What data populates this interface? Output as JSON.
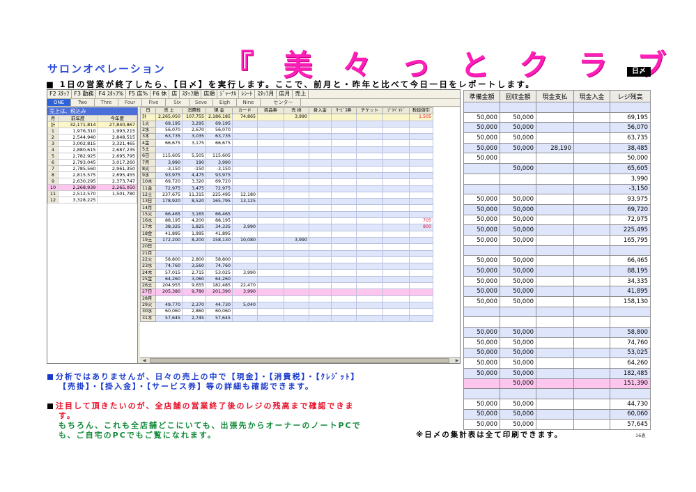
{
  "header": {
    "subtitle": "サロンオペレーション",
    "brand": "『 美 々 っ と ク ラ ブ 』",
    "icon_label": "日〆",
    "intro": "■ 1日の営業が終了したら、【日〆】を実行します。ここで、前月と・昨年と比べて今日一日をレポートします。"
  },
  "window": {
    "menu": [
      "F2 ｽﾀｯﾌ",
      "F3 勤務",
      "F4 ｽﾀｯﾌ%",
      "F5 店%",
      "F6 休",
      "店",
      "ｽﾀｯﾌ順",
      "店順",
      "ｼﾞｬｰﾅﾙ",
      "ﾚｼｰﾄ",
      "ｽﾀｯﾌ月",
      "店月",
      "売上"
    ],
    "tabs": [
      "ONE",
      "Two",
      "Thre",
      "Four",
      "Five",
      "Six",
      "Seve",
      "Eigh",
      "Nine"
    ],
    "tab_center": "センター",
    "left_title": "売上は、税込み",
    "left_headers": [
      "月",
      "前年度",
      "今年度"
    ],
    "left_rows": [
      [
        "計",
        "32,171,814",
        "27,840,867"
      ],
      [
        "1",
        "1,976,310",
        "1,993,215"
      ],
      [
        "2",
        "2,544,940",
        "2,848,515"
      ],
      [
        "3",
        "3,002,815",
        "3,321,465"
      ],
      [
        "4",
        "2,880,615",
        "2,687,235"
      ],
      [
        "5",
        "2,782,925",
        "2,695,795"
      ],
      [
        "6",
        "2,793,045",
        "3,017,260"
      ],
      [
        "7",
        "2,785,560",
        "2,961,350"
      ],
      [
        "8",
        "2,815,575",
        "2,695,455"
      ],
      [
        "9",
        "2,630,295",
        "2,373,747"
      ],
      [
        "10",
        "2,268,939",
        "2,265,050"
      ],
      [
        "11",
        "2,512,570",
        "1,501,780"
      ],
      [
        "12",
        "3,328,225",
        ""
      ]
    ],
    "grid_headers": [
      "日",
      "売 上",
      "消費税",
      "現 金",
      "カード",
      "商品券",
      "売 掛",
      "掛入金",
      "ｻｰﾋﾞｽ券",
      "チケット",
      "ﾌﾟﾘﾍﾟｲﾄﾞ",
      "税抜値引"
    ],
    "grid_rows": [
      [
        "計",
        "2,265,050",
        "107,755",
        "2,186,185",
        "74,865",
        "",
        "3,990",
        "",
        "",
        "",
        "",
        "1,505"
      ],
      [
        "1火",
        "69,195",
        "3,295",
        "69,195",
        "",
        "",
        "",
        "",
        "",
        "",
        "",
        ""
      ],
      [
        "2水",
        "56,070",
        "2,670",
        "56,070",
        "",
        "",
        "",
        "",
        "",
        "",
        "",
        ""
      ],
      [
        "3木",
        "63,735",
        "3,035",
        "63,735",
        "",
        "",
        "",
        "",
        "",
        "",
        "",
        ""
      ],
      [
        "4金",
        "66,675",
        "3,175",
        "66,675",
        "",
        "",
        "",
        "",
        "",
        "",
        "",
        ""
      ],
      [
        "5土",
        "",
        "",
        "",
        "",
        "",
        "",
        "",
        "",
        "",
        "",
        ""
      ],
      [
        "6日",
        "115,605",
        "5,505",
        "115,605",
        "",
        "",
        "",
        "",
        "",
        "",
        "",
        ""
      ],
      [
        "7月",
        "3,990",
        "190",
        "3,990",
        "",
        "",
        "",
        "",
        "",
        "",
        "",
        ""
      ],
      [
        "8火",
        "-3,150",
        "-150",
        "-3,150",
        "",
        "",
        "",
        "",
        "",
        "",
        "",
        ""
      ],
      [
        "9水",
        "93,975",
        "4,475",
        "93,975",
        "",
        "",
        "",
        "",
        "",
        "",
        "",
        ""
      ],
      [
        "10木",
        "69,720",
        "3,320",
        "69,720",
        "",
        "",
        "",
        "",
        "",
        "",
        "",
        ""
      ],
      [
        "11金",
        "72,975",
        "3,475",
        "72,975",
        "",
        "",
        "",
        "",
        "",
        "",
        "",
        ""
      ],
      [
        "12土",
        "237,675",
        "11,315",
        "225,495",
        "12,180",
        "",
        "",
        "",
        "",
        "",
        "",
        ""
      ],
      [
        "13日",
        "178,920",
        "8,520",
        "165,795",
        "13,125",
        "",
        "",
        "",
        "",
        "",
        "",
        ""
      ],
      [
        "14月",
        "",
        "",
        "",
        "",
        "",
        "",
        "",
        "",
        "",
        "",
        ""
      ],
      [
        "15火",
        "66,465",
        "3,165",
        "66,465",
        "",
        "",
        "",
        "",
        "",
        "",
        "",
        ""
      ],
      [
        "16水",
        "88,195",
        "4,200",
        "88,195",
        "",
        "",
        "",
        "",
        "",
        "",
        "",
        "705"
      ],
      [
        "17木",
        "38,325",
        "1,825",
        "34,335",
        "3,990",
        "",
        "",
        "",
        "",
        "",
        "",
        "800"
      ],
      [
        "18金",
        "41,895",
        "1,995",
        "41,895",
        "",
        "",
        "",
        "",
        "",
        "",
        "",
        ""
      ],
      [
        "19土",
        "172,200",
        "8,200",
        "158,130",
        "10,080",
        "",
        "3,990",
        "",
        "",
        "",
        "",
        ""
      ],
      [
        "20日",
        "",
        "",
        "",
        "",
        "",
        "",
        "",
        "",
        "",
        "",
        ""
      ],
      [
        "21月",
        "",
        "",
        "",
        "",
        "",
        "",
        "",
        "",
        "",
        "",
        ""
      ],
      [
        "22火",
        "58,800",
        "2,800",
        "58,800",
        "",
        "",
        "",
        "",
        "",
        "",
        "",
        ""
      ],
      [
        "23水",
        "74,760",
        "3,560",
        "74,760",
        "",
        "",
        "",
        "",
        "",
        "",
        "",
        ""
      ],
      [
        "24木",
        "57,015",
        "2,715",
        "53,025",
        "3,990",
        "",
        "",
        "",
        "",
        "",
        "",
        ""
      ],
      [
        "25金",
        "64,260",
        "3,060",
        "64,260",
        "",
        "",
        "",
        "",
        "",
        "",
        "",
        ""
      ],
      [
        "26土",
        "204,955",
        "9,655",
        "182,485",
        "22,470",
        "",
        "",
        "",
        "",
        "",
        "",
        ""
      ],
      [
        "27日",
        "205,380",
        "9,780",
        "201,390",
        "3,990",
        "",
        "",
        "",
        "",
        "",
        "",
        ""
      ],
      [
        "28月",
        "",
        "",
        "",
        "",
        "",
        "",
        "",
        "",
        "",
        "",
        ""
      ],
      [
        "29火",
        "49,770",
        "2,370",
        "44,730",
        "5,040",
        "",
        "",
        "",
        "",
        "",
        "",
        ""
      ],
      [
        "30水",
        "60,060",
        "2,860",
        "60,060",
        "",
        "",
        "",
        "",
        "",
        "",
        "",
        ""
      ],
      [
        "31木",
        "57,645",
        "2,745",
        "57,645",
        "",
        "",
        "",
        "",
        "",
        "",
        "",
        ""
      ]
    ]
  },
  "register": {
    "headers": [
      "準備金額",
      "回収金額",
      "現金支払",
      "現金入金",
      "レジ残高"
    ],
    "rows": [
      [
        "",
        "",
        "",
        "",
        ""
      ],
      [
        "50,000",
        "50,000",
        "",
        "",
        "69,195"
      ],
      [
        "50,000",
        "50,000",
        "",
        "",
        "56,070"
      ],
      [
        "50,000",
        "50,000",
        "",
        "",
        "63,735"
      ],
      [
        "50,000",
        "50,000",
        "28,190",
        "",
        "38,485"
      ],
      [
        "50,000",
        "",
        "",
        "",
        "50,000"
      ],
      [
        "",
        "50,000",
        "",
        "",
        "65,605"
      ],
      [
        "",
        "",
        "",
        "",
        "3,990"
      ],
      [
        "",
        "",
        "",
        "",
        "-3,150"
      ],
      [
        "50,000",
        "50,000",
        "",
        "",
        "93,975"
      ],
      [
        "50,000",
        "50,000",
        "",
        "",
        "69,720"
      ],
      [
        "50,000",
        "50,000",
        "",
        "",
        "72,975"
      ],
      [
        "50,000",
        "50,000",
        "",
        "",
        "225,495"
      ],
      [
        "50,000",
        "50,000",
        "",
        "",
        "165,795"
      ],
      [
        "",
        "",
        "",
        "",
        ""
      ],
      [
        "50,000",
        "50,000",
        "",
        "",
        "66,465"
      ],
      [
        "50,000",
        "50,000",
        "",
        "",
        "88,195"
      ],
      [
        "50,000",
        "50,000",
        "",
        "",
        "34,335"
      ],
      [
        "50,000",
        "50,000",
        "",
        "",
        "41,895"
      ],
      [
        "50,000",
        "50,000",
        "",
        "",
        "158,130"
      ],
      [
        "",
        "",
        "",
        "",
        ""
      ],
      [
        "",
        "",
        "",
        "",
        ""
      ],
      [
        "50,000",
        "50,000",
        "",
        "",
        "58,800"
      ],
      [
        "50,000",
        "50,000",
        "",
        "",
        "74,760"
      ],
      [
        "50,000",
        "50,000",
        "",
        "",
        "53,025"
      ],
      [
        "50,000",
        "50,000",
        "",
        "",
        "64,260"
      ],
      [
        "50,000",
        "50,000",
        "",
        "",
        "182,485"
      ],
      [
        "",
        "50,000",
        "",
        "",
        "151,390"
      ],
      [
        "",
        "",
        "",
        "",
        ""
      ],
      [
        "50,000",
        "50,000",
        "",
        "",
        "44,730"
      ],
      [
        "50,000",
        "50,000",
        "",
        "",
        "60,060"
      ],
      [
        "50,000",
        "50,000",
        "",
        "",
        "57,645"
      ]
    ]
  },
  "notes": {
    "n1a": "分析ではありませんが、日々の売上の中で【現金】・【消費税】・【ｸﾚｼﾞｯﾄ】",
    "n1b": "【売掛】・【掛入金】・【サービス券】等の詳細も確認できます。",
    "n2a": "注目して頂きたいのが、全店舗の営業終了後のレジの残高まで確認できま",
    "n2b": "す。",
    "n3a": "もちろん、これも全店舗どこにいても、出張先からオーナーのノートPCで",
    "n3b": "も、ご自宅のPCでもご覧になれます。",
    "n4": "※日〆の集計表は全て印刷できます。",
    "page": "16表"
  },
  "colors": {
    "brand": "#ff1fb8",
    "subtitle": "#2b4ad8",
    "highlight_row": "#fec6ee",
    "alt_row": "#dfe6fb",
    "note_blue": "#1a3acb",
    "note_red": "#e8102a",
    "note_green": "#128a3a"
  }
}
